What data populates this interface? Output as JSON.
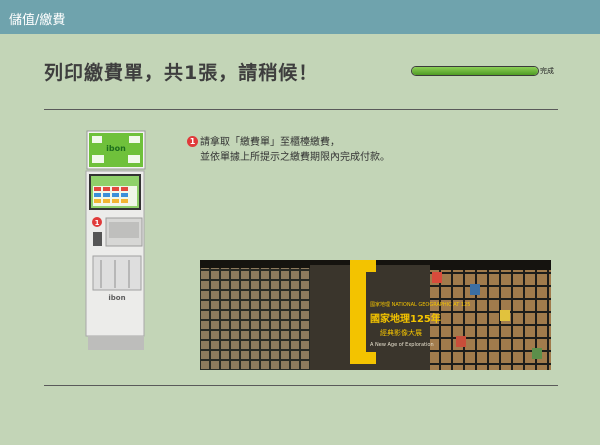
{
  "header": {
    "title": "儲值/繳費"
  },
  "main": {
    "headline": "列印繳費單，共1張，請稍候！",
    "progress": {
      "label": "完成",
      "fraction": 1.0
    },
    "instruction": {
      "step": "1",
      "line1": "請拿取「繳費單」至櫃檯繳費，",
      "line2": "並依單據上所提示之繳費期限內完成付款。"
    },
    "kiosk": {
      "brand": "ibon",
      "marker": "1"
    },
    "ad": {
      "badge": "國家地理 NATIONAL GEOGRAPHIC AT 125",
      "title": "國家地理125年",
      "subtitle": "經典影像大展",
      "tagline": "A New Age of Exploration"
    }
  },
  "colors": {
    "header_bar": "#6fa3ad",
    "background": "#c3d5b7",
    "accent": "#f3c300"
  }
}
